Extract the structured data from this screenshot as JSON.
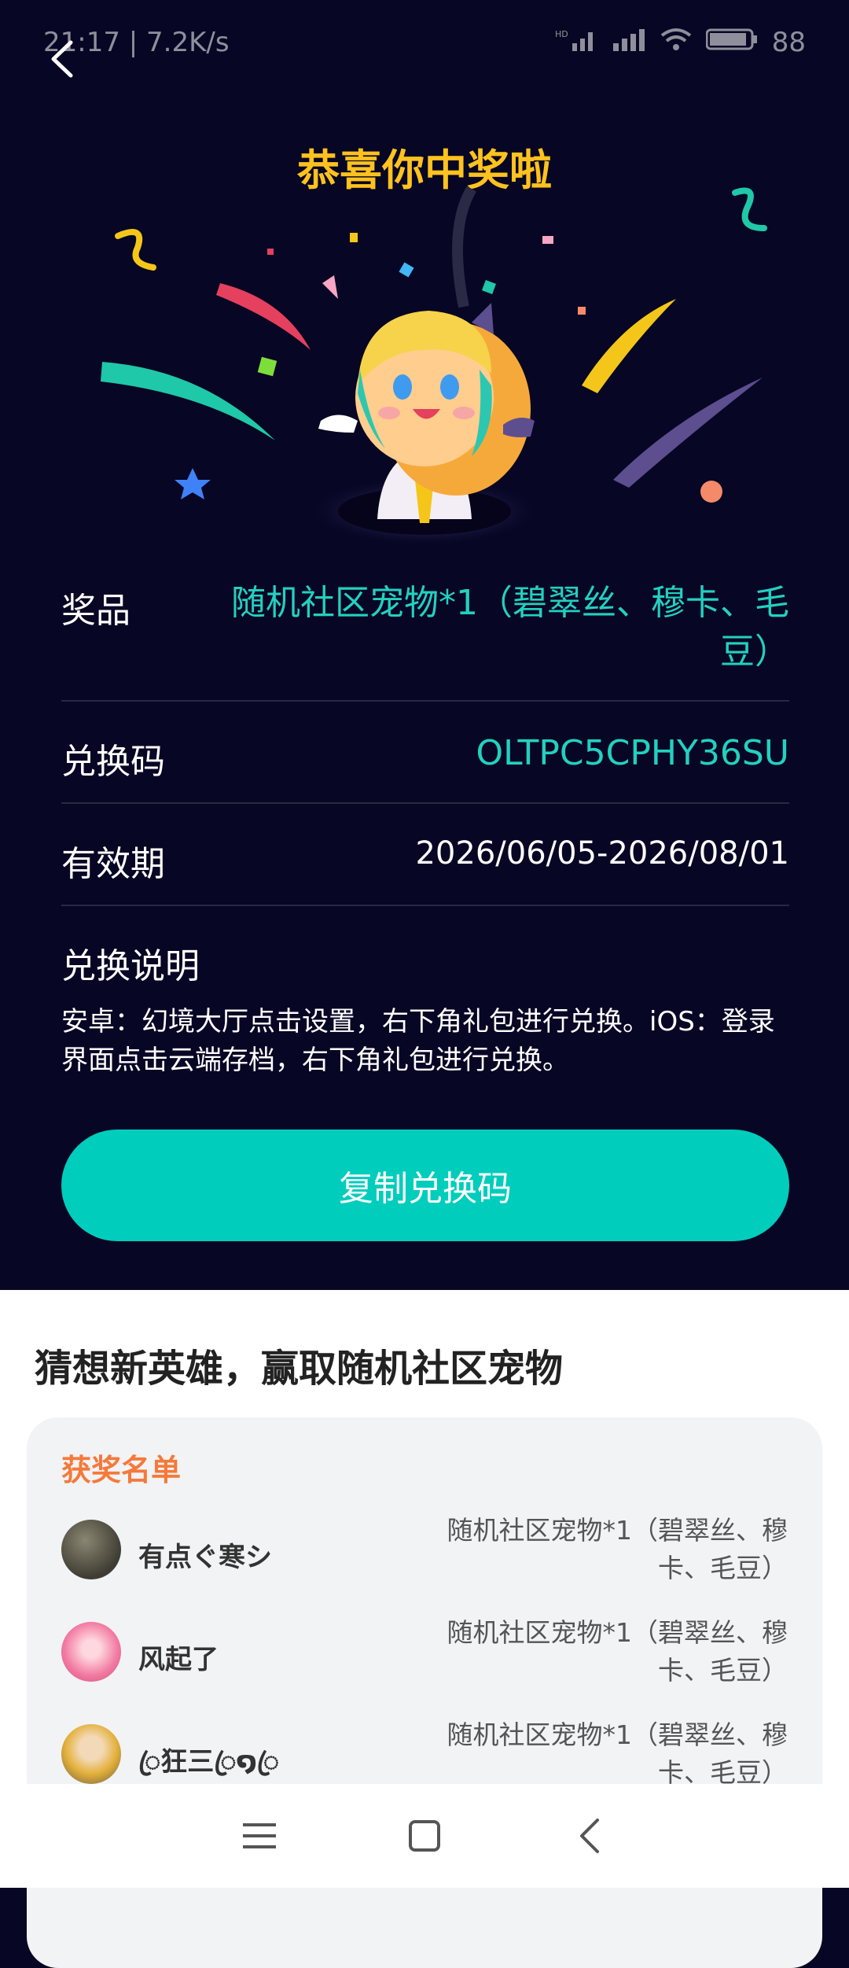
{
  "status_bar": {
    "time_speed": "21:17 | 7.2K/s",
    "icons": [
      "hd-signal-icon",
      "signal-icon",
      "wifi-icon",
      "battery-icon"
    ],
    "battery": "88"
  },
  "header": {
    "back_icon": "chevron-left-icon",
    "title": "恭喜你中奖啦"
  },
  "prize": {
    "label": "奖品",
    "value_line1": "随机社区宠物*1（碧翠丝、穆卡、毛",
    "value_line2": "豆）"
  },
  "code": {
    "label": "兑换码",
    "value": "OLTPC5CPHY36SU"
  },
  "validity": {
    "label": "有效期",
    "value": "2026/06/05-2026/08/01"
  },
  "instructions": {
    "label": "兑换说明",
    "text": "安卓：幻境大厅点击设置，右下角礼包进行兑换。iOS：登录界面点击云端存档，右下角礼包进行兑换。"
  },
  "copy_button": {
    "label": "复制兑换码"
  },
  "activity": {
    "title": "猜想新英雄，赢取随机社区宠物",
    "winners_title": "获奖名单",
    "winners": [
      {
        "name": "有点ぐ寒シ",
        "prize_line1": "随机社区宠物*1（碧翠丝、穆",
        "prize_line2": "卡、毛豆）"
      },
      {
        "name": "风起了",
        "prize_line1": "随机社区宠物*1（碧翠丝、穆",
        "prize_line2": "卡、毛豆）"
      },
      {
        "name": "ꦿ狂三ꦿ໑ꦿ",
        "prize_line1": "随机社区宠物*1（碧翠丝、穆",
        "prize_line2": "卡、毛豆）"
      }
    ]
  },
  "nav": {
    "icons": [
      "menu-icon",
      "home-square-icon",
      "back-triangle-icon"
    ]
  },
  "colors": {
    "background": "#070624",
    "accent": "#00CDBC",
    "title_gold": "#FFC21E",
    "winners_orange": "#F5793A"
  }
}
